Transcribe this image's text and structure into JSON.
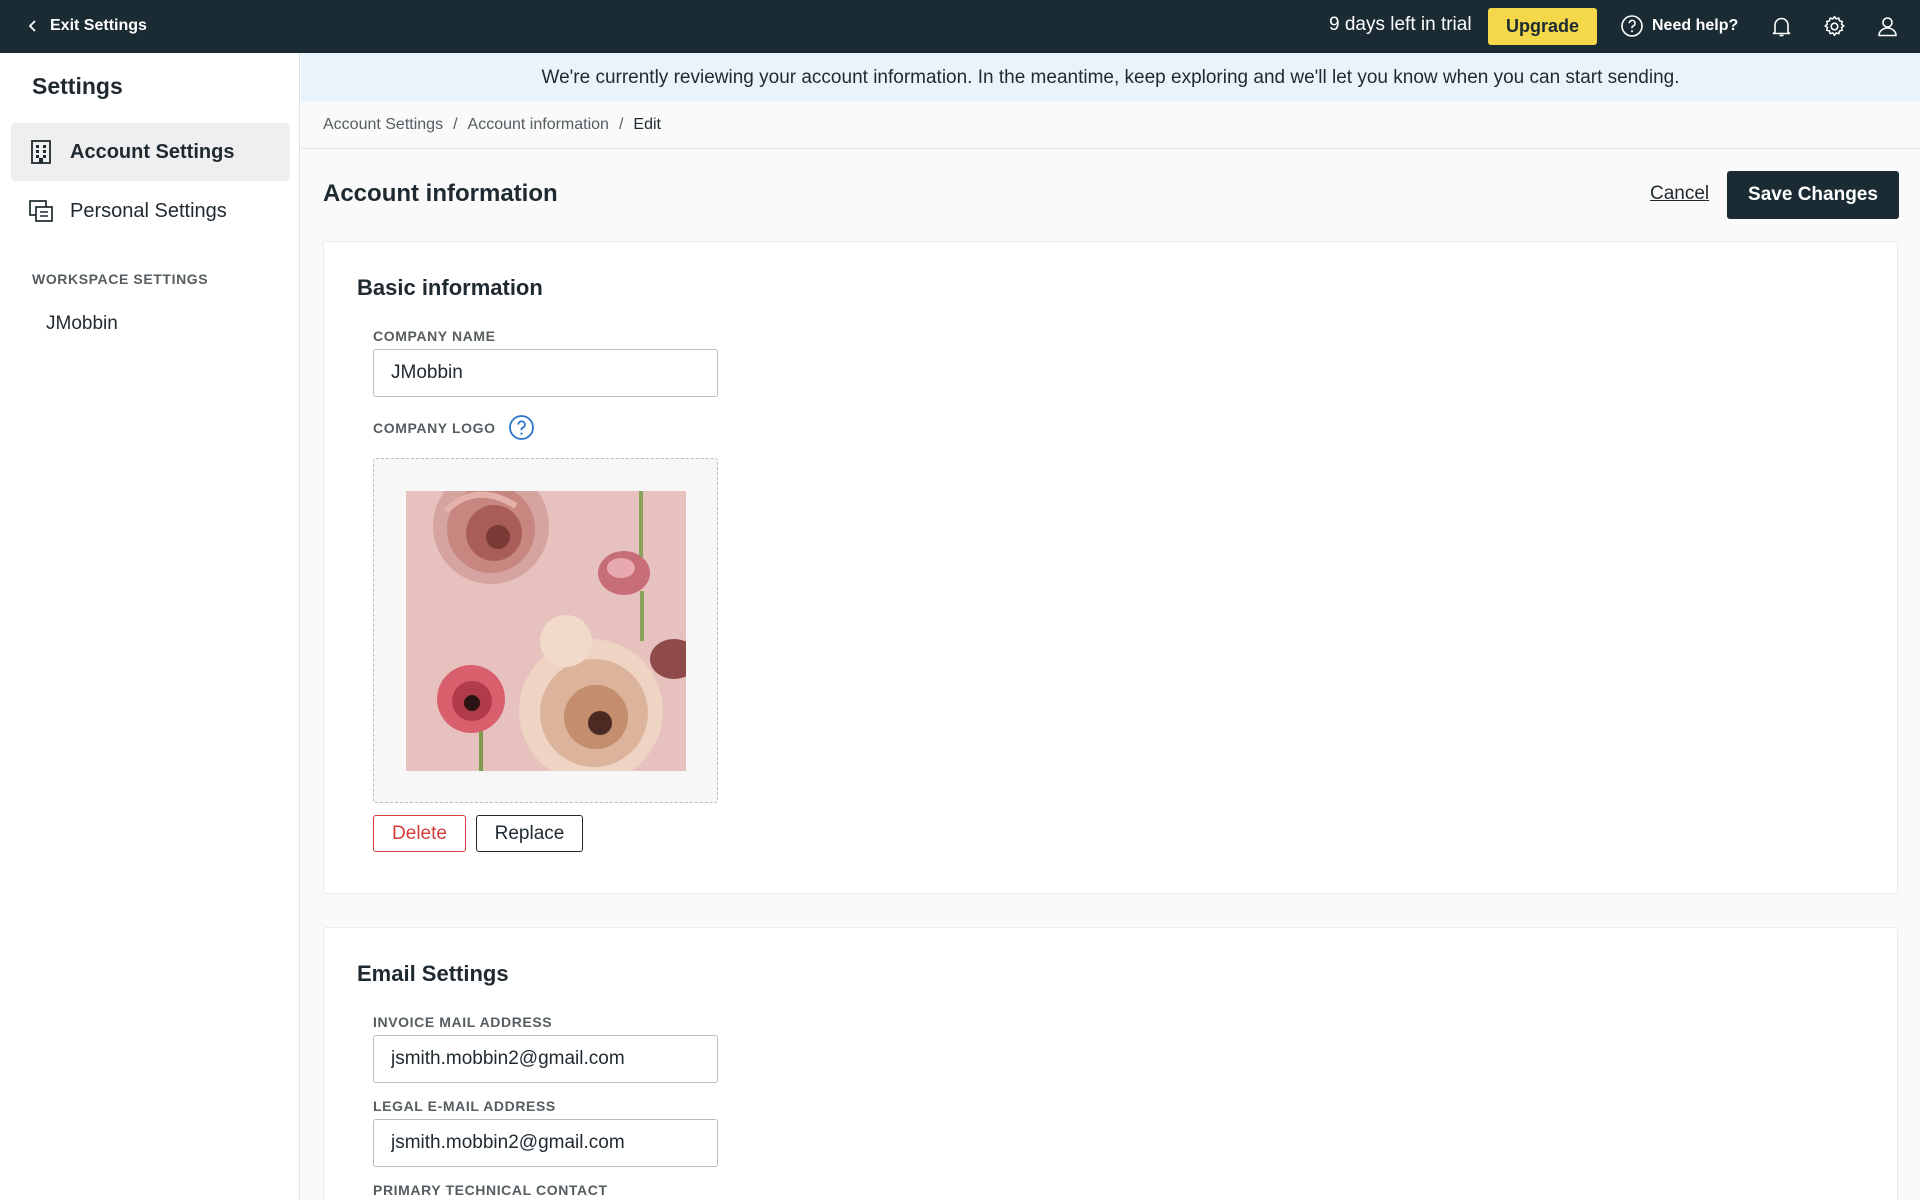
{
  "topbar": {
    "exit_label": "Exit Settings",
    "trial_text": "9 days left in trial",
    "upgrade_label": "Upgrade",
    "help_label": "Need help?"
  },
  "sidebar": {
    "title": "Settings",
    "items": [
      {
        "label": "Account Settings",
        "icon": "building-icon",
        "active": true
      },
      {
        "label": "Personal Settings",
        "icon": "profile-card-icon",
        "active": false
      }
    ],
    "section_label": "WORKSPACE SETTINGS",
    "workspace": "JMobbin"
  },
  "banner": {
    "text": "We're currently reviewing your account information. In the meantime, keep exploring and we'll let you know when you can start sending."
  },
  "breadcrumb": [
    "Account Settings",
    "Account information",
    "Edit"
  ],
  "page": {
    "title": "Account information",
    "cancel_label": "Cancel",
    "save_label": "Save Changes"
  },
  "basic": {
    "title": "Basic information",
    "company_name_label": "COMPANY NAME",
    "company_name_value": "JMobbin",
    "company_logo_label": "COMPANY LOGO",
    "delete_label": "Delete",
    "replace_label": "Replace"
  },
  "email": {
    "title": "Email Settings",
    "invoice_label": "INVOICE MAIL ADDRESS",
    "invoice_value": "jsmith.mobbin2@gmail.com",
    "legal_label": "LEGAL E-MAIL ADDRESS",
    "legal_value": "jsmith.mobbin2@gmail.com",
    "technical_label": "PRIMARY TECHNICAL CONTACT"
  },
  "colors": {
    "topbar": "#1a2b33",
    "upgrade": "#f5d84a",
    "banner": "#e8f3fc",
    "danger": "#d23c3c",
    "info": "#2a73c9"
  }
}
